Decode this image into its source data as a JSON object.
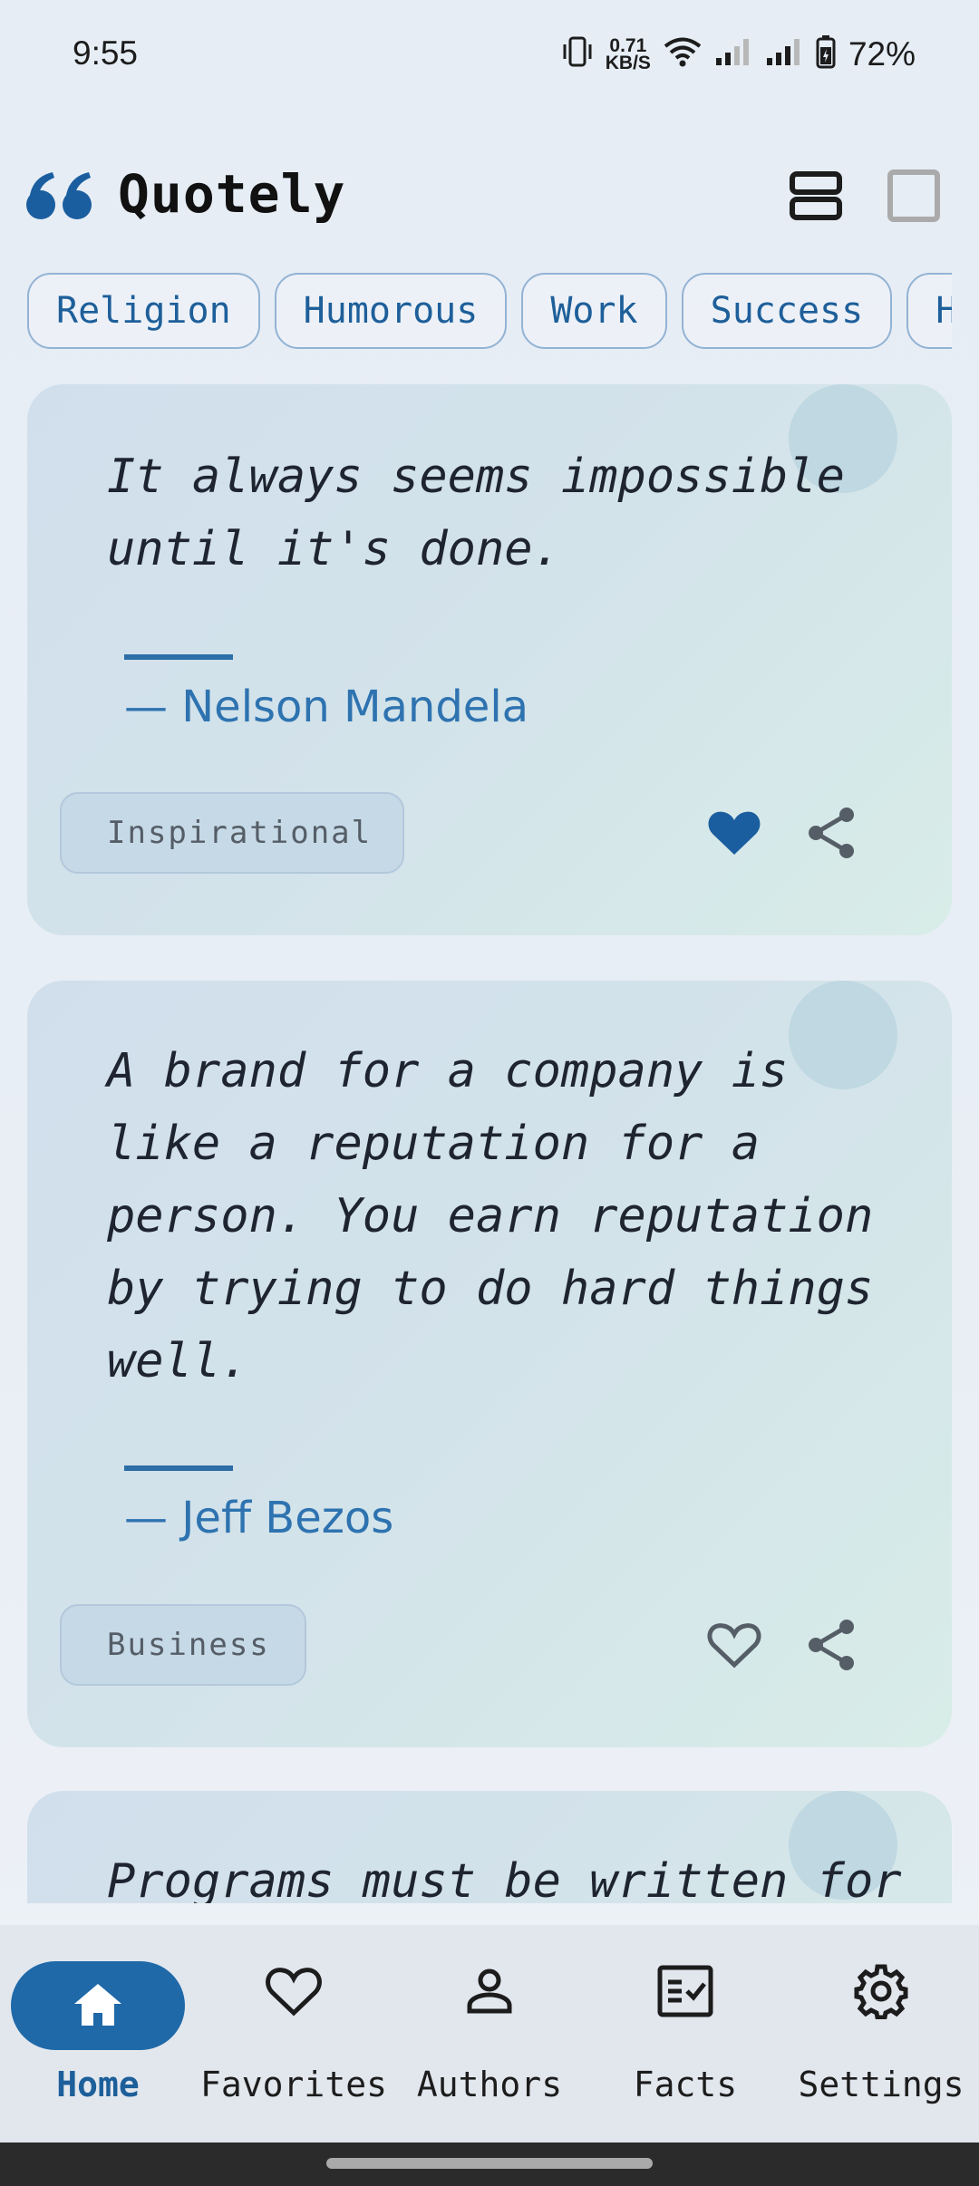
{
  "status_bar": {
    "time": "9:55",
    "net_speed_value": "0.71",
    "net_speed_unit": "KB/S",
    "battery": "72%"
  },
  "app": {
    "title": "Quotely",
    "accent": "#1f69a8"
  },
  "categories": [
    "Religion",
    "Humorous",
    "Work",
    "Success",
    "H"
  ],
  "quotes": [
    {
      "text": "It always seems impossible until it's done.",
      "author": "— Nelson Mandela",
      "tag": "Inspirational",
      "favorited": true
    },
    {
      "text": "A brand for a company is like a reputation for a person. You earn reputation by trying to do hard things well.",
      "author": "— Jeff Bezos",
      "tag": "Business",
      "favorited": false
    },
    {
      "text": "Programs must be written for",
      "author": "",
      "tag": "",
      "favorited": false
    }
  ],
  "nav": [
    {
      "label": "Home",
      "icon": "home-icon",
      "active": true
    },
    {
      "label": "Favorites",
      "icon": "heart-icon",
      "active": false
    },
    {
      "label": "Authors",
      "icon": "person-icon",
      "active": false
    },
    {
      "label": "Facts",
      "icon": "fact-check-icon",
      "active": false
    },
    {
      "label": "Settings",
      "icon": "gear-icon",
      "active": false
    }
  ]
}
